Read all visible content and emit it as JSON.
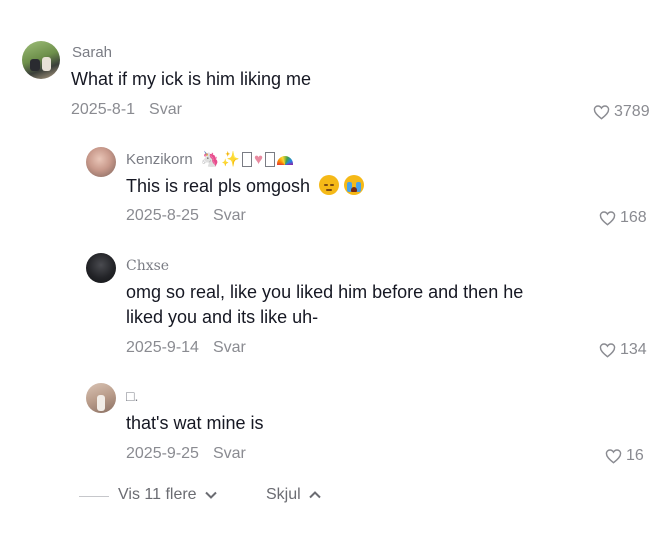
{
  "comments": [
    {
      "username": "Sarah",
      "text": "What if my ick is him liking me",
      "date": "2025-8-1",
      "reply_label": "Svar",
      "likes": "3789"
    },
    {
      "username": "Kenzikorn",
      "username_emojis": [
        "unicorn",
        "sparkles",
        "box",
        "heart",
        "box",
        "rainbow"
      ],
      "text": "This is real pls omgosh",
      "text_emojis": [
        "pensive-face",
        "crying-face"
      ],
      "date": "2025-8-25",
      "reply_label": "Svar",
      "likes": "168"
    },
    {
      "username": "Chxse",
      "text_line1": "omg so real, like you liked him before and then he",
      "text_line2": "liked you and its like uh-",
      "date": "2025-9-14",
      "reply_label": "Svar",
      "likes": "134"
    },
    {
      "username": "□.",
      "text": "that's wat mine is",
      "date": "2025-9-25",
      "reply_label": "Svar",
      "likes": "16"
    }
  ],
  "footer": {
    "show_more_label": "Vis 11 flere",
    "hide_label": "Skjul"
  }
}
